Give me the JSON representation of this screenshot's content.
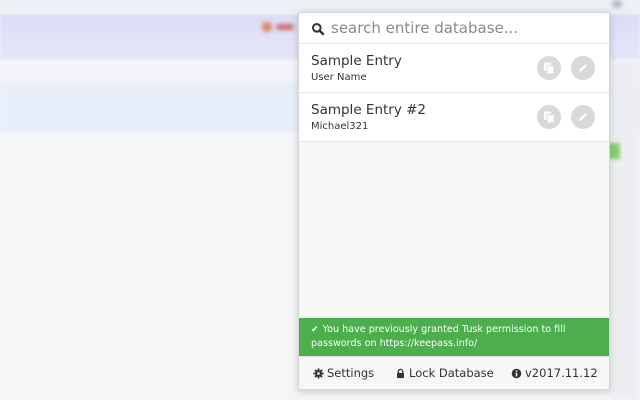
{
  "search": {
    "placeholder": "search entire database..."
  },
  "entries": [
    {
      "title": "Sample Entry",
      "username": "User Name"
    },
    {
      "title": "Sample Entry #2",
      "username": "Michael321"
    }
  ],
  "notice": {
    "text": "You have previously granted Tusk permission to fill passwords on https://keepass.info/",
    "color": "#4cae4c"
  },
  "footer": {
    "settings_label": "Settings",
    "lock_label": "Lock Database",
    "version_label": "v2017.11.12"
  },
  "icons": [
    "search-icon",
    "copy-icon",
    "pencil-icon",
    "check-icon",
    "gear-icon",
    "lock-icon",
    "info-icon"
  ]
}
